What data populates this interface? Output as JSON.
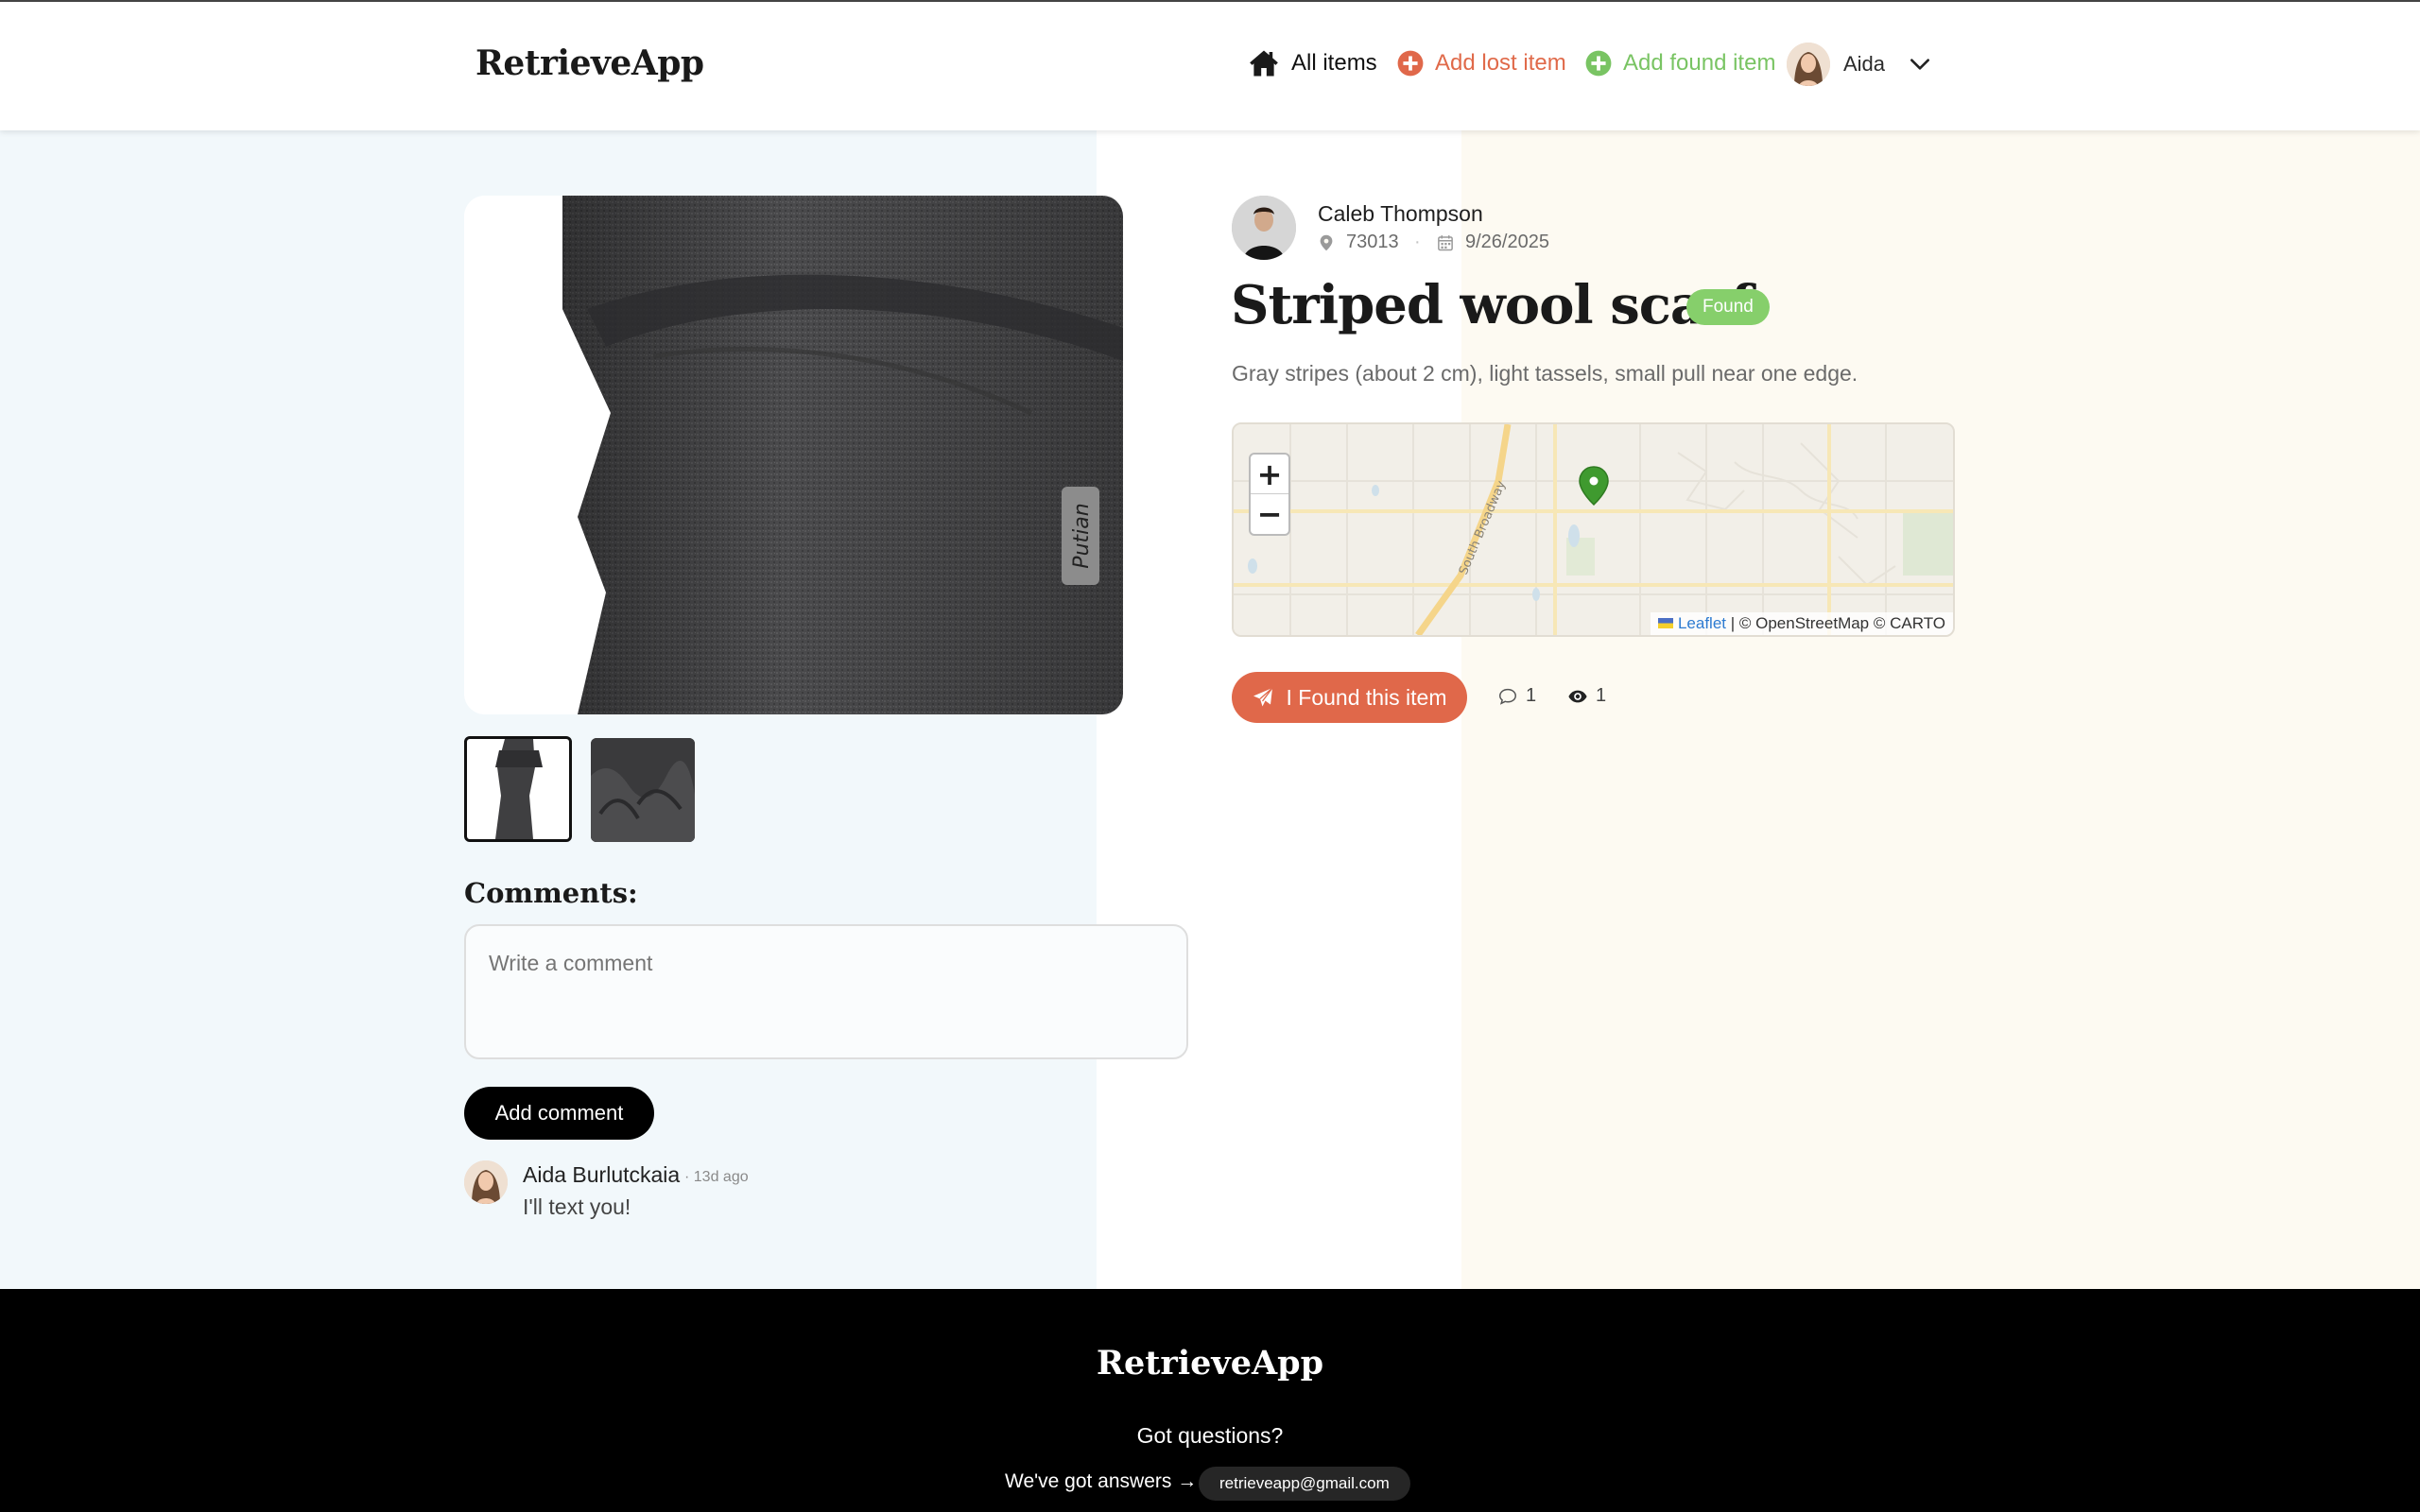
{
  "header": {
    "logo": "RetrieveApp",
    "nav": {
      "all_items": "All items",
      "add_lost": "Add lost item",
      "add_found": "Add found item"
    },
    "user_name": "Aida"
  },
  "item": {
    "poster_name": "Caleb Thompson",
    "zip": "73013",
    "date": "9/26/2025",
    "title": "Striped wool scarf",
    "status": "Found",
    "description": "Gray stripes (about 2 cm), light tassels, small pull near one edge.",
    "photo_label": "Putian",
    "found_button": "I Found this item",
    "comment_count": "1",
    "view_count": "1"
  },
  "map": {
    "zoom_in": "+",
    "zoom_out": "−",
    "street_label": "South Broadway",
    "attribution_leaflet": "Leaflet",
    "attribution_rest": " | © OpenStreetMap © CARTO",
    "pin_color": "#3f9a2f"
  },
  "comments": {
    "title": "Comments:",
    "placeholder": "Write a comment",
    "add_button": "Add comment",
    "items": [
      {
        "author": "Aida Burlutckaia",
        "time": "· 13d ago",
        "text": "I'll text you!"
      }
    ]
  },
  "footer": {
    "logo": "RetrieveApp",
    "question": "Got questions?",
    "answers": "We've got answers →",
    "email": "retrieveapp@gmail.com"
  },
  "colors": {
    "accent_orange": "#e0684a",
    "accent_green": "#79c463",
    "badge_green": "#86cf6b"
  }
}
